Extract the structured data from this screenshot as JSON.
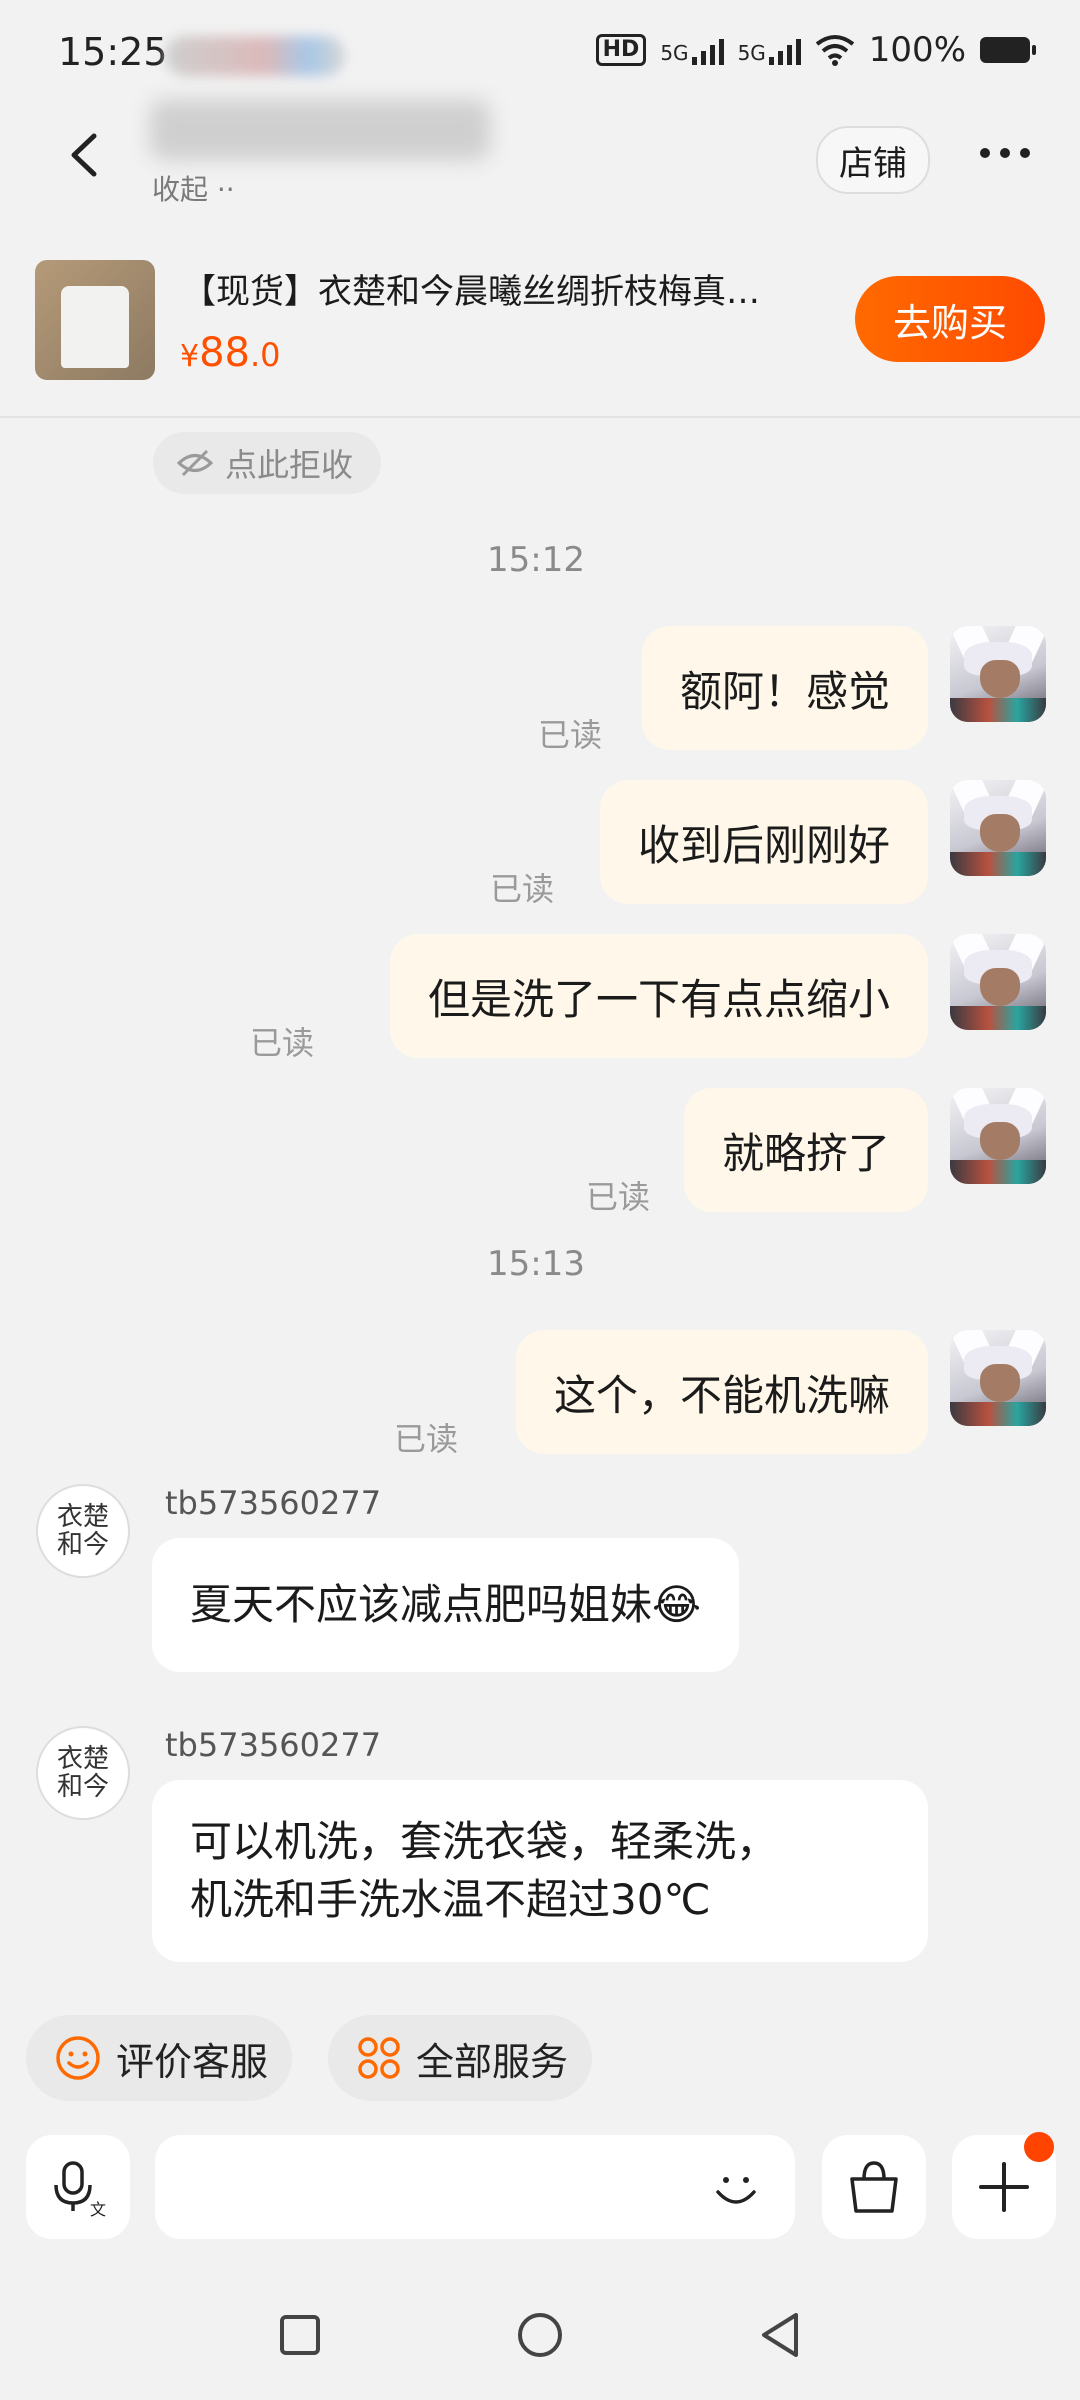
{
  "status_bar": {
    "time": "15:25",
    "network_labels": [
      "5G",
      "5G"
    ],
    "battery": "100%"
  },
  "header": {
    "subtitle": "收起 ··",
    "shop_button": "店铺"
  },
  "product": {
    "title": "【现货】衣楚和今晨曦丝绸折枝梅真…",
    "currency": "¥",
    "price_int": "88",
    "price_dec": ".0",
    "buy_button": "去购买"
  },
  "reject_label": "点此拒收",
  "timestamps": [
    "15:12",
    "15:13"
  ],
  "read_label": "已读",
  "outgoing": [
    {
      "text": "额阿！感觉"
    },
    {
      "text": "收到后刚刚好"
    },
    {
      "text": "但是洗了一下有点点缩小"
    },
    {
      "text": "就略挤了"
    },
    {
      "text": "这个，不能机洗嘛"
    }
  ],
  "incoming": [
    {
      "sender": "tb573560277",
      "text": "夏天不应该减点肥吗姐妹😂"
    },
    {
      "sender": "tb573560277",
      "text": "可以机洗，套洗衣袋，轻柔洗，\n机洗和手洗水温不超过30℃"
    }
  ],
  "shop_avatar_text": "衣楚\n和今",
  "quick_actions": [
    {
      "label": "评价客服",
      "icon": "smile-circle-icon"
    },
    {
      "label": "全部服务",
      "icon": "grid-services-icon"
    }
  ],
  "colors": {
    "accent": "#ff5000",
    "bubble_out": "#fff8ea",
    "bubble_in": "#ffffff",
    "background": "#f2f2f2"
  }
}
